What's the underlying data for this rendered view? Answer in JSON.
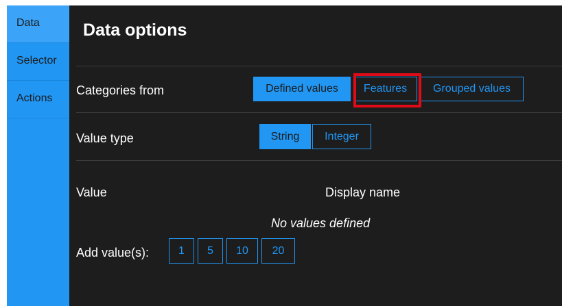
{
  "sidebar": {
    "items": [
      {
        "label": "Data",
        "active": true
      },
      {
        "label": "Selector",
        "active": false
      },
      {
        "label": "Actions",
        "active": false
      }
    ]
  },
  "main": {
    "title": "Data options",
    "categories": {
      "label": "Categories from",
      "options": [
        "Defined values",
        "Features",
        "Grouped values"
      ],
      "selected": "Defined values",
      "highlighted": "Features"
    },
    "value_type": {
      "label": "Value type",
      "options": [
        "String",
        "Integer"
      ],
      "selected": "String"
    },
    "table": {
      "value_header": "Value",
      "display_header": "Display name",
      "empty_text": "No values defined"
    },
    "add_values": {
      "label": "Add value(s):",
      "buttons": [
        "1",
        "5",
        "10",
        "20"
      ]
    }
  },
  "colors": {
    "accent": "#2196f3",
    "background": "#1d1d1d",
    "highlight_box": "#e10b17"
  }
}
